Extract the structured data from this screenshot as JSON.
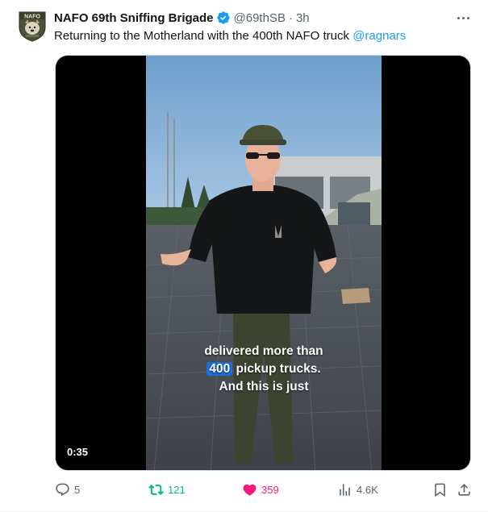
{
  "author": {
    "name": "NAFO 69th Sniffing Brigade",
    "handle": "@69thSB",
    "separator": "·",
    "time": "3h",
    "verified": true,
    "avatar_icon": "nafo-dog-avatar",
    "avatar_text": "NAFO"
  },
  "tweet": {
    "text": "Returning to the Motherland with the 400th NAFO truck ",
    "mention": "@ragnars"
  },
  "media": {
    "type": "video",
    "duration": "0:35",
    "caption_line1": "delivered more than",
    "caption_highlight": "400",
    "caption_line2_rest": " pickup trucks.",
    "caption_line3": "And this is just"
  },
  "actions": {
    "replies": "5",
    "retweets": "121",
    "likes": "359",
    "views": "4.6K",
    "liked": true,
    "retweeted": true
  },
  "colors": {
    "accent": "#1d9bf0",
    "retweet": "#00ba7c",
    "like": "#f91880",
    "muted": "#536471"
  }
}
